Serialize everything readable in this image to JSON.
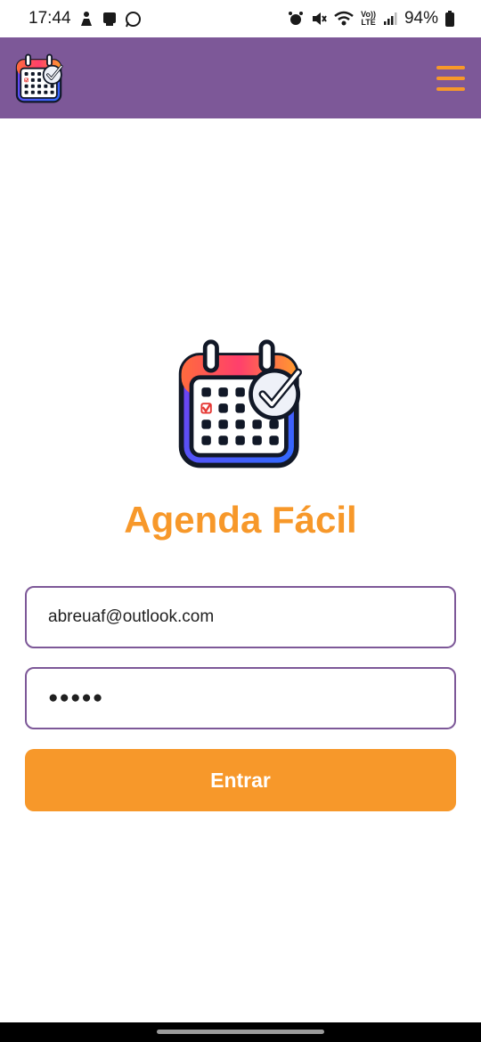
{
  "status_bar": {
    "time": "17:44",
    "left_icons": [
      "activity-icon",
      "device-icon",
      "whatsapp-icon"
    ],
    "right_icons": [
      "alarm-icon",
      "mute-icon",
      "wifi-icon",
      "volte-icon",
      "signal-icon",
      "battery-icon"
    ],
    "volte_top": "Vo))",
    "volte_bottom": "LTE",
    "battery_percent": "94%"
  },
  "app_bar": {
    "logo": "calendar-check-icon",
    "menu": "hamburger-menu-icon",
    "background_color": "#7d5898",
    "accent_color": "#f7982a"
  },
  "login": {
    "logo": "calendar-check-icon",
    "title": "Agenda Fácil",
    "email_value": "abreuaf@outlook.com",
    "password_value": "●●●●●",
    "submit_label": "Entrar"
  }
}
